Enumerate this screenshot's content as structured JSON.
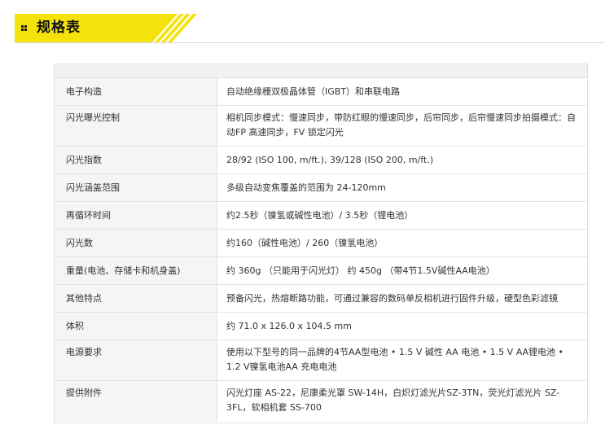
{
  "header": {
    "title": "规格表",
    "accent_color": "#f5e20a"
  },
  "specs": [
    {
      "label": "电子构造",
      "value": "自动绝缘栅双极晶体管（IGBT）和串联电路"
    },
    {
      "label": "闪光曝光控制",
      "value": "相机同步模式：慢速同步，带防红眼的慢速同步，后帘同步，后帘慢速同步拍摄模式：自动FP 高速同步，FV 锁定闪光"
    },
    {
      "label": "闪光指数",
      "value": "28/92 (ISO 100, m/ft.), 39/128 (ISO 200, m/ft.)"
    },
    {
      "label": "闪光涵盖范围",
      "value": "多级自动变焦覆盖的范围为 24-120mm"
    },
    {
      "label": "再循环时间",
      "value": "约2.5秒（镍氢或碱性电池）/ 3.5秒（锂电池）"
    },
    {
      "label": "闪光数",
      "value": "约160（碱性电池）/ 260（镍氢电池）"
    },
    {
      "label": "重量(电池、存储卡和机身盖)",
      "value": "约 360g （只能用于闪光灯） 约 450g （带4节1.5V碱性AA电池）"
    },
    {
      "label": "其他特点",
      "value": "预备闪光，热熔断路功能，可通过兼容的数码单反相机进行固件升级，硬型色彩滤镜"
    },
    {
      "label": "体积",
      "value": "约 71.0 x 126.0 x 104.5 mm"
    },
    {
      "label": "电源要求",
      "value": "使用以下型号的同一品牌的4节AA型电池 • 1.5 V 碱性 AA 电池 • 1.5 V AA锂电池 • 1.2 V镍氢电池AA 充电电池"
    },
    {
      "label": "提供附件",
      "value": "闪光灯座 AS-22，尼康柔光罩 SW-14H，白炽灯滤光片SZ-3TN，荧光灯滤光片 SZ-3FL，软相机套 SS-700"
    }
  ]
}
